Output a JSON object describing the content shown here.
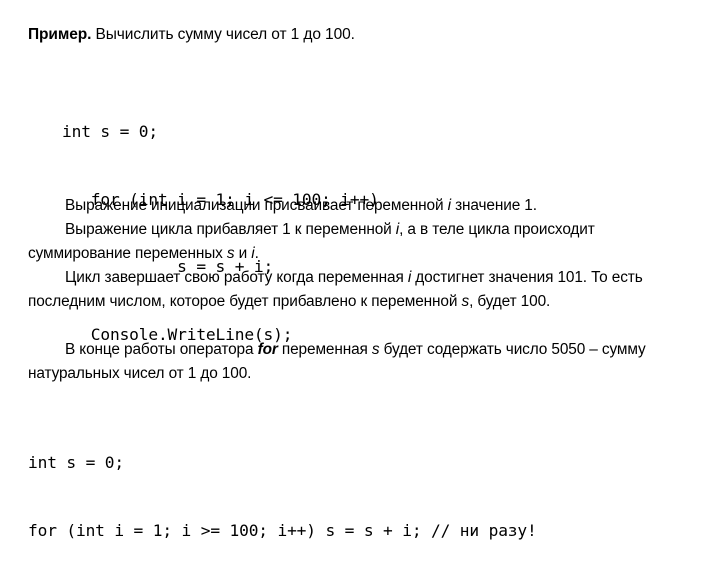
{
  "slide": {
    "lead": {
      "bold_label": "Пример.",
      "rest": " Вычислить сумму чисел от 1 до 100."
    },
    "code_main": {
      "name": "for-loop-sum-example",
      "lines": [
        "int s = 0;",
        "   for (int i = 1; i <= 100; i++)",
        "            s = s + i;",
        "   Console.WriteLine(s);"
      ]
    },
    "paragraphs": [
      {
        "id": "initialization-expression",
        "parts": [
          {
            "text": "Выражение инициализации присваивает переменной ",
            "style": "normal"
          },
          {
            "text": "i",
            "style": "italic"
          },
          {
            "text": " значение 1.",
            "style": "normal"
          }
        ]
      },
      {
        "id": "loop-expression",
        "parts": [
          {
            "text": "Выражение цикла прибавляет 1 к переменной ",
            "style": "normal"
          },
          {
            "text": "i",
            "style": "italic"
          },
          {
            "text": ", а в теле цикла происходит суммирование переменных ",
            "style": "normal"
          },
          {
            "text": "s",
            "style": "italic"
          },
          {
            "text": " и ",
            "style": "normal"
          },
          {
            "text": "i",
            "style": "italic"
          },
          {
            "text": ".",
            "style": "normal"
          }
        ]
      },
      {
        "id": "loop-termination",
        "parts": [
          {
            "text": "Цикл завершает свою работу когда переменная ",
            "style": "normal"
          },
          {
            "text": "i",
            "style": "italic"
          },
          {
            "text": " достигнет значения 101. То есть последним числом, которое будет прибавлено к переменной ",
            "style": "normal"
          },
          {
            "text": "s",
            "style": "italic"
          },
          {
            "text": ", будет 100.",
            "style": "normal"
          }
        ]
      },
      {
        "id": "final-result",
        "parts": [
          {
            "text": "В конце работы оператора ",
            "style": "normal"
          },
          {
            "text": "for",
            "style": "bold-italic"
          },
          {
            "text": " переменная ",
            "style": "normal"
          },
          {
            "text": "s",
            "style": "italic"
          },
          {
            "text": " будет содержать число 5050 – сумму натуральных чисел от 1 до 100.",
            "style": "normal"
          }
        ]
      }
    ],
    "code_trap": {
      "name": "never-executing-for-loop",
      "lines": [
        "int s = 0;",
        "for (int i = 1; i >= 100; i++) s = s + i; // ни разу!"
      ]
    }
  }
}
